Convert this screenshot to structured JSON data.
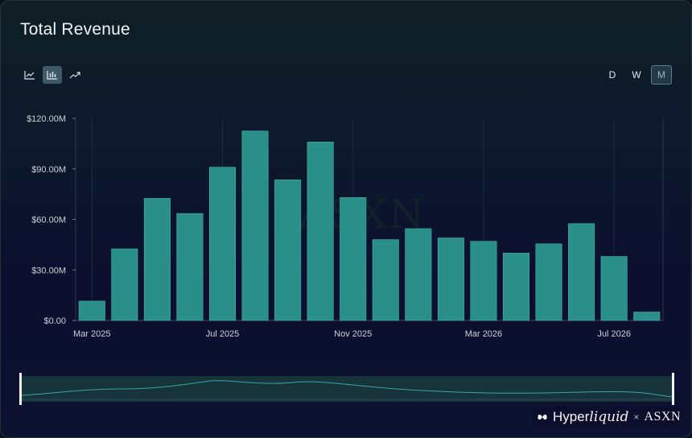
{
  "title": "Total Revenue",
  "toolbar": {
    "icons": [
      "line-chart-icon",
      "bar-chart-icon",
      "trend-icon"
    ],
    "active": "bar-chart-icon"
  },
  "periods": [
    {
      "label": "D",
      "active": false
    },
    {
      "label": "W",
      "active": false
    },
    {
      "label": "M",
      "active": true
    }
  ],
  "watermark": "ASXN",
  "brand": {
    "hyper": "Hyper",
    "liquid": "liquid",
    "sep": "×",
    "partner": "ASXN"
  },
  "colors": {
    "bar": "#2a8f88",
    "bar_stroke": "#3fb3aa",
    "axis_text": "#c9d3d9",
    "grid": "#2a3948"
  },
  "chart_data": {
    "type": "bar",
    "title": "Total Revenue",
    "xlabel": "",
    "ylabel": "",
    "x": [
      "2025-02",
      "2025-03",
      "2025-04",
      "2025-05",
      "2025-06",
      "2025-07",
      "2025-08",
      "2025-09",
      "2025-10",
      "2025-11",
      "2025-12",
      "2026-01",
      "2026-02",
      "2026-03",
      "2026-04",
      "2026-05",
      "2026-06",
      "2026-07"
    ],
    "values": [
      11.5,
      42.5,
      72.5,
      63.5,
      91,
      112.5,
      83.5,
      106,
      73,
      48,
      54.5,
      49,
      47,
      40,
      45.5,
      57.5,
      38,
      5
    ],
    "ylim": [
      0,
      120
    ],
    "yticks": [
      0,
      30,
      60,
      90,
      120
    ],
    "ytick_labels": [
      "$0.00",
      "$30.00M",
      "$60.00M",
      "$90.00M",
      "$120.00M"
    ],
    "xticks": [
      {
        "label": "Mar 2025",
        "index": 0.5
      },
      {
        "label": "Jul 2025",
        "index": 4.5
      },
      {
        "label": "Nov 2025",
        "index": 8.5
      },
      {
        "label": "Mar 2026",
        "index": 12.5
      },
      {
        "label": "Jul 2026",
        "index": 16.5
      }
    ],
    "grid": false,
    "legend": "none"
  }
}
